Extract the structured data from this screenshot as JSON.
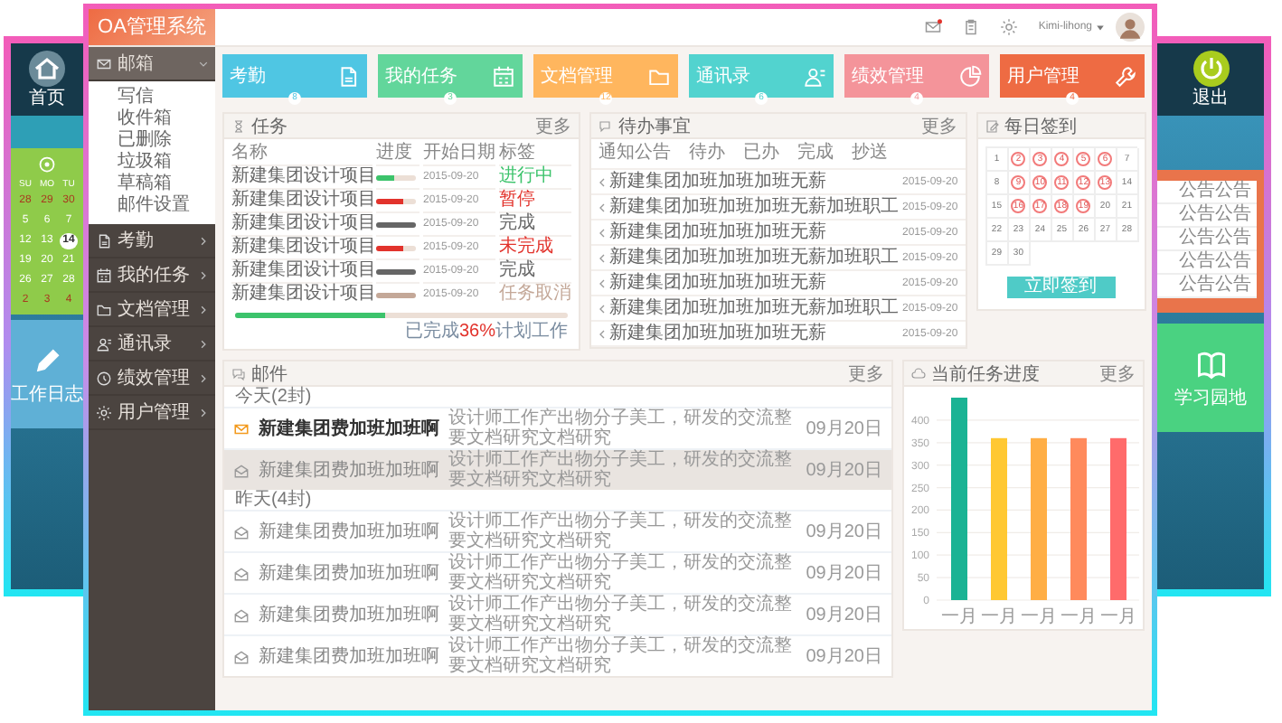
{
  "background_app": {
    "left": {
      "nav": [
        {
          "label": "首页"
        }
      ],
      "calendar": {
        "weekdays": [
          "SU",
          "MO",
          "TU"
        ],
        "days": [
          {
            "day": "28",
            "other_month": true,
            "selected": false
          },
          {
            "day": "29",
            "other_month": true,
            "selected": false
          },
          {
            "day": "30",
            "other_month": true,
            "selected": false
          },
          {
            "day": "5",
            "other_month": false,
            "selected": false
          },
          {
            "day": "6",
            "other_month": false,
            "selected": false
          },
          {
            "day": "7",
            "other_month": false,
            "selected": false
          },
          {
            "day": "12",
            "other_month": false,
            "selected": false
          },
          {
            "day": "13",
            "other_month": false,
            "selected": false
          },
          {
            "day": "14",
            "other_month": false,
            "selected": true
          },
          {
            "day": "19",
            "other_month": false,
            "selected": false
          },
          {
            "day": "20",
            "other_month": false,
            "selected": false
          },
          {
            "day": "21",
            "other_month": false,
            "selected": false
          },
          {
            "day": "26",
            "other_month": false,
            "selected": false
          },
          {
            "day": "27",
            "other_month": false,
            "selected": false
          },
          {
            "day": "28",
            "other_month": false,
            "selected": false
          },
          {
            "day": "2",
            "other_month": true,
            "selected": false
          },
          {
            "day": "3",
            "other_month": true,
            "selected": false
          },
          {
            "day": "4",
            "other_month": true,
            "selected": false
          }
        ]
      },
      "tile": {
        "label": "工作日志"
      }
    },
    "right": {
      "nav": [
        {
          "label": "退出"
        }
      ],
      "notices": [
        "公告公告",
        "公告公告",
        "公告公告",
        "公告公告",
        "公告公告"
      ],
      "tile": {
        "label": "学习园地"
      }
    }
  },
  "app": {
    "title": "OA管理系统",
    "header": {
      "mail_unread": true,
      "user": "Kimi-lihong"
    },
    "sidebar": {
      "items": [
        {
          "label": "邮箱",
          "expanded": true,
          "children": [
            "写信",
            "收件箱",
            "已删除",
            "垃圾箱",
            "草稿箱",
            "邮件设置"
          ]
        },
        {
          "label": "考勤",
          "expanded": false
        },
        {
          "label": "我的任务",
          "expanded": false
        },
        {
          "label": "文档管理",
          "expanded": false
        },
        {
          "label": "通讯录",
          "expanded": false
        },
        {
          "label": "绩效管理",
          "expanded": false
        },
        {
          "label": "用户管理",
          "expanded": false
        }
      ]
    },
    "tiles": [
      {
        "label": "考勤",
        "count": "8",
        "color": "#4fc6e3"
      },
      {
        "label": "我的任务",
        "count": "3",
        "color": "#62d69b"
      },
      {
        "label": "文档管理",
        "count": "12",
        "color": "#ffb65e"
      },
      {
        "label": "通讯录",
        "count": "6",
        "color": "#52d3cf"
      },
      {
        "label": "绩效管理",
        "count": "4",
        "color": "#f4949a"
      },
      {
        "label": "用户管理",
        "count": "4",
        "color": "#ee6b43"
      }
    ],
    "tasks": {
      "title": "任务",
      "more": "更多",
      "columns": [
        "名称",
        "进度",
        "开始日期",
        "标签"
      ],
      "rows": [
        {
          "name": "新建集团设计项目",
          "level": 0.45,
          "start": "2015-09-20",
          "tag": "进行中",
          "color": "#3cc36b"
        },
        {
          "name": "新建集团设计项目",
          "level": 0.7,
          "start": "2015-09-20",
          "tag": "暂停",
          "color": "#e2332c"
        },
        {
          "name": "新建集团设计项目",
          "level": 1,
          "start": "2015-09-20",
          "tag": "完成",
          "color": "#666666"
        },
        {
          "name": "新建集团设计项目",
          "level": 0.7,
          "start": "2015-09-20",
          "tag": "未完成",
          "color": "#e2332c"
        },
        {
          "name": "新建集团设计项目",
          "level": 1,
          "start": "2015-09-20",
          "tag": "完成",
          "color": "#666666"
        },
        {
          "name": "新建集团设计项目",
          "level": 1,
          "start": "2015-09-20",
          "tag": "任务取消",
          "color": "#c4a898"
        }
      ],
      "overall": {
        "level": 0.45,
        "before": "已完成",
        "value": "36%",
        "after": "计划工作"
      }
    },
    "todo": {
      "title": "待办事宜",
      "more": "更多",
      "tabs": [
        "通知公告",
        "待办",
        "已办",
        "完成",
        "抄送"
      ],
      "items": [
        {
          "text": "新建集团加班加班加班无薪",
          "date": "2015-09-20"
        },
        {
          "text": "新建集团加班加班加班无薪加班职工",
          "date": "2015-09-20"
        },
        {
          "text": "新建集团加班加班加班无薪",
          "date": "2015-09-20"
        },
        {
          "text": "新建集团加班加班加班无薪加班职工",
          "date": "2015-09-20"
        },
        {
          "text": "新建集团加班加班加班无薪",
          "date": "2015-09-20"
        },
        {
          "text": "新建集团加班加班加班无薪加班职工",
          "date": "2015-09-20"
        },
        {
          "text": "新建集团加班加班加班无薪",
          "date": "2015-09-20"
        }
      ]
    },
    "checkin": {
      "title": "每日签到",
      "button": "立即签到",
      "days": [
        {
          "day": "1",
          "signed": false
        },
        {
          "day": "2",
          "signed": true
        },
        {
          "day": "3",
          "signed": true
        },
        {
          "day": "4",
          "signed": true
        },
        {
          "day": "5",
          "signed": true
        },
        {
          "day": "6",
          "signed": true
        },
        {
          "day": "7",
          "signed": false
        },
        {
          "day": "8",
          "signed": false
        },
        {
          "day": "9",
          "signed": true
        },
        {
          "day": "10",
          "signed": true
        },
        {
          "day": "11",
          "signed": true
        },
        {
          "day": "12",
          "signed": true
        },
        {
          "day": "13",
          "signed": true
        },
        {
          "day": "14",
          "signed": false
        },
        {
          "day": "15",
          "signed": false
        },
        {
          "day": "16",
          "signed": true
        },
        {
          "day": "17",
          "signed": true
        },
        {
          "day": "18",
          "signed": true
        },
        {
          "day": "19",
          "signed": true
        },
        {
          "day": "20",
          "signed": false
        },
        {
          "day": "21",
          "signed": false
        },
        {
          "day": "22",
          "signed": false
        },
        {
          "day": "23",
          "signed": false
        },
        {
          "day": "24",
          "signed": false
        },
        {
          "day": "25",
          "signed": false
        },
        {
          "day": "26",
          "signed": false
        },
        {
          "day": "27",
          "signed": false
        },
        {
          "day": "28",
          "signed": false
        },
        {
          "day": "29",
          "signed": false
        },
        {
          "day": "30",
          "signed": false
        }
      ]
    },
    "mail": {
      "title": "邮件",
      "more": "更多",
      "groups": [
        {
          "label": "今天(2封)",
          "mails": [
            {
              "subject": "新建集团费加班加班啊",
              "body": "设计师工作产出物分子美工，研发的交流整要文档研究文档研究",
              "date": "09月20日",
              "unread": true,
              "selected": false
            },
            {
              "subject": "新建集团费加班加班啊",
              "body": "设计师工作产出物分子美工，研发的交流整要文档研究文档研究",
              "date": "09月20日",
              "unread": false,
              "selected": true
            }
          ]
        },
        {
          "label": "昨天(4封)",
          "mails": [
            {
              "subject": "新建集团费加班加班啊",
              "body": "设计师工作产出物分子美工，研发的交流整要文档研究文档研究",
              "date": "09月20日",
              "unread": false,
              "selected": false
            },
            {
              "subject": "新建集团费加班加班啊",
              "body": "设计师工作产出物分子美工，研发的交流整要文档研究文档研究",
              "date": "09月20日",
              "unread": false,
              "selected": false
            },
            {
              "subject": "新建集团费加班加班啊",
              "body": "设计师工作产出物分子美工，研发的交流整要文档研究文档研究",
              "date": "09月20日",
              "unread": false,
              "selected": false
            },
            {
              "subject": "新建集团费加班加班啊",
              "body": "设计师工作产出物分子美工，研发的交流整要文档研究文档研究",
              "date": "09月20日",
              "unread": false,
              "selected": false
            }
          ]
        }
      ]
    },
    "progress_chart": {
      "title": "当前任务进度",
      "more": "更多",
      "chart_data": {
        "type": "bar",
        "categories": [
          "一月",
          "一月",
          "一月",
          "一月",
          "一月"
        ],
        "grid": true,
        "series": [
          {
            "color": "#1ab394",
            "values": [
              450,
              null,
              null,
              null,
              null
            ]
          },
          {
            "color": "#ffc832",
            "values": [
              null,
              360,
              null,
              null,
              null
            ]
          },
          {
            "color": "#ffae45",
            "values": [
              null,
              null,
              360,
              null,
              null
            ]
          },
          {
            "color": "#ff8a5c",
            "values": [
              null,
              null,
              null,
              360,
              null
            ]
          },
          {
            "color": "#ff6b6b",
            "values": [
              null,
              null,
              null,
              null,
              360
            ]
          }
        ],
        "ylim": [
          0,
          450
        ],
        "yticks": [
          0,
          50,
          100,
          150,
          200,
          250,
          300,
          350,
          400
        ]
      }
    }
  }
}
